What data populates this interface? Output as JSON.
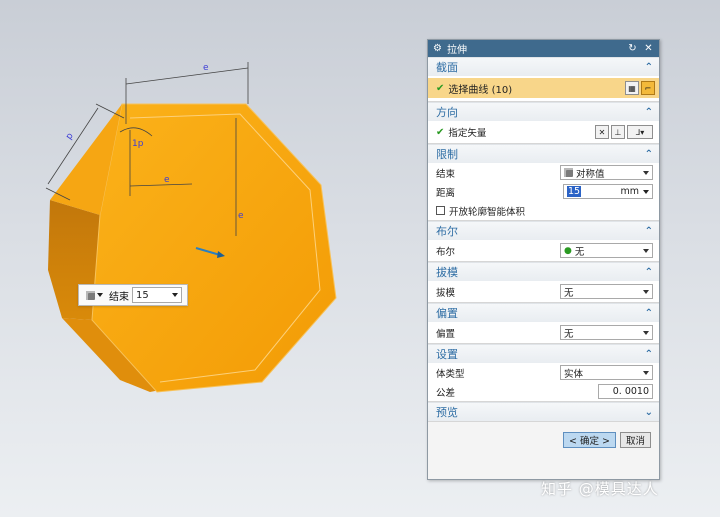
{
  "viewport": {
    "part_color": "#f5a30a",
    "dimension_labels": {
      "top": "e",
      "left_edge": "p",
      "corner": "1p",
      "inner_h": "e",
      "inner_v": "e"
    },
    "mini_toolbar": {
      "icon": "solid-body-icon",
      "label": "结束",
      "value": "15"
    }
  },
  "dialog": {
    "title": "拉伸",
    "sections": {
      "section": {
        "title": "截面",
        "select_curve_label": "选择曲线 (10)"
      },
      "direction": {
        "title": "方向",
        "vector_label": "指定矢量"
      },
      "limits": {
        "title": "限制",
        "end_label": "结束",
        "end_value": "对称值",
        "distance_label": "距离",
        "distance_value": "15",
        "distance_unit": "mm",
        "open_profile_label": "开放轮廓智能体积"
      },
      "boolean": {
        "title": "布尔",
        "boolean_label": "布尔",
        "boolean_value": "无"
      },
      "draft": {
        "title": "拔模",
        "draft_label": "拔模",
        "draft_value": "无"
      },
      "offset": {
        "title": "偏置",
        "offset_label": "偏置",
        "offset_value": "无"
      },
      "settings": {
        "title": "设置",
        "body_type_label": "体类型",
        "body_type_value": "实体",
        "tolerance_label": "公差",
        "tolerance_value": "0. 0010"
      },
      "preview": {
        "title": "预览"
      }
    },
    "ok_label": "< 确定 >",
    "cancel_label": "取消"
  },
  "watermark": "知乎 @模具达人"
}
